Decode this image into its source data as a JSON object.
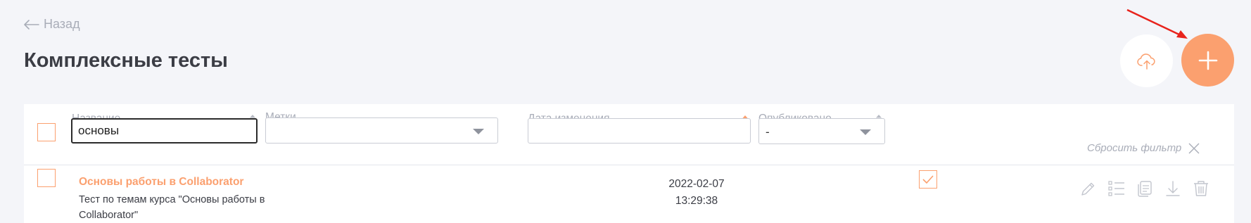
{
  "header": {
    "back_label": "Назад",
    "title": "Комплексные тесты"
  },
  "toolbar": {
    "upload_icon": "cloud-upload-icon",
    "add_icon": "plus-icon"
  },
  "filters": {
    "columns": {
      "name": "Название",
      "tags": "Метки",
      "date": "Дата изменения",
      "published": "Опубликовано"
    },
    "name_value": "основы",
    "tags_value": "",
    "date_value": "",
    "published_value": "-",
    "reset_label": "Сбросить фильтр"
  },
  "rows": [
    {
      "title": "Основы работы в Collaborator",
      "description": "Тест по темам курса \"Основы работы в Collaborator\"",
      "date": "2022-02-07",
      "time": "13:29:38",
      "published": true
    }
  ],
  "colors": {
    "accent": "#fba06f",
    "background": "#f4f5f9",
    "muted_text": "#a9adb8",
    "annotation_arrow": "#e8231c"
  }
}
